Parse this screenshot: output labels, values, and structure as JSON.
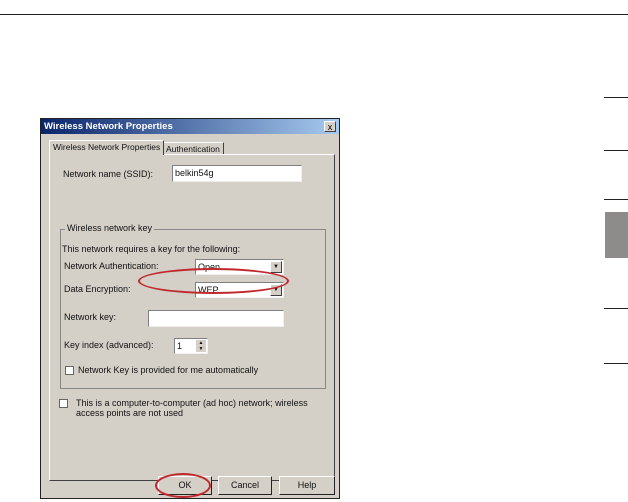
{
  "dialog": {
    "title": "Wireless Network Properties",
    "close": "x",
    "tabs": [
      "Wireless Network Properties",
      "Authentication"
    ],
    "ssid_label": "Network name (SSID):",
    "ssid_value": "belkin54g",
    "group_label": "Wireless network key",
    "requires_text": "This network requires a key for the following:",
    "auth_label": "Network Authentication:",
    "auth_value": "Open",
    "enc_label": "Data Encryption:",
    "enc_value": "WEP",
    "key_label": "Network key:",
    "key_value": "",
    "index_label": "Key index (advanced):",
    "index_value": "1",
    "auto_key_label": "Network Key is provided for me automatically",
    "adhoc_label": "This is a computer-to-computer (ad hoc) network; wireless access points are not used",
    "ok": "OK",
    "cancel": "Cancel",
    "help": "Help"
  },
  "colors": {
    "highlight": "#c0282e",
    "section_tab": "#8e8c8a"
  }
}
